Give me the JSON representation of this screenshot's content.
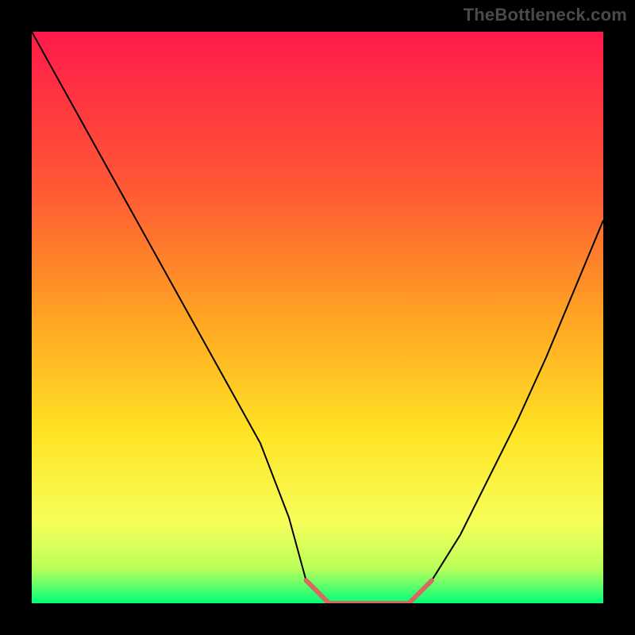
{
  "watermark": "TheBottleneck.com",
  "chart_data": {
    "type": "line",
    "title": "",
    "xlabel": "",
    "ylabel": "",
    "xlim": [
      0,
      100
    ],
    "ylim": [
      0,
      100
    ],
    "grid": false,
    "legend": false,
    "gradient_stops": [
      {
        "offset": 0.0,
        "color": "#ff1a4b"
      },
      {
        "offset": 0.28,
        "color": "#ff5a33"
      },
      {
        "offset": 0.5,
        "color": "#ffa423"
      },
      {
        "offset": 0.7,
        "color": "#ffe324"
      },
      {
        "offset": 0.86,
        "color": "#f6ff5a"
      },
      {
        "offset": 0.94,
        "color": "#b9ff5a"
      },
      {
        "offset": 1.0,
        "color": "#00ff7a"
      }
    ],
    "series": [
      {
        "name": "bottleneck-curve",
        "stroke": "#000000",
        "stroke_width": 2,
        "x": [
          0,
          5,
          10,
          15,
          20,
          25,
          30,
          35,
          40,
          45,
          48,
          52,
          55,
          58,
          62,
          66,
          70,
          75,
          80,
          85,
          90,
          95,
          100
        ],
        "y": [
          100,
          91,
          82,
          73,
          64,
          55,
          46,
          37,
          28,
          15,
          4,
          0,
          0,
          0,
          0,
          0,
          4,
          12,
          22,
          32,
          43,
          55,
          67
        ]
      },
      {
        "name": "flat-bottom-marker",
        "stroke": "#d66a5e",
        "stroke_width": 6,
        "x": [
          48,
          50,
          52,
          55,
          58,
          62,
          66,
          70
        ],
        "y": [
          4,
          2,
          0,
          0,
          0,
          0,
          0,
          4
        ]
      }
    ]
  }
}
